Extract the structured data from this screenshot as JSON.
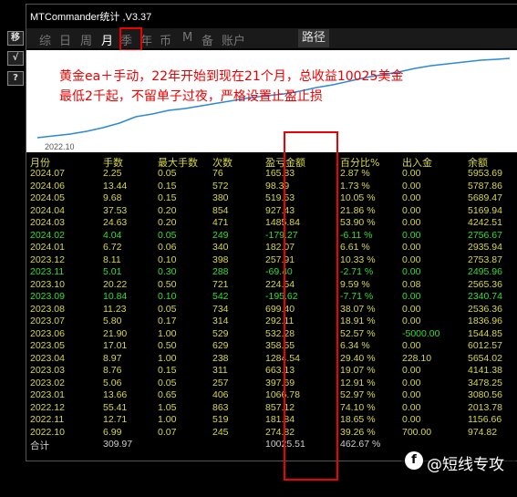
{
  "window": {
    "title": "MTCommander统计 ,V3.37"
  },
  "toolbar": {
    "buttons": [
      "移",
      "√",
      "?"
    ]
  },
  "nav": {
    "items": [
      "综",
      "日",
      "周",
      "月",
      "季",
      "年",
      "币",
      "M",
      "备",
      "账户"
    ],
    "active": "月",
    "path_button": "路径"
  },
  "chart": {
    "overlay_line1": "黄金ea＋手动，22年开始到现在21个月，总收益10025美金",
    "overlay_line2": "最低2千起，不留单子过夜，严格设置止盈止损",
    "axis_label": "2022.10"
  },
  "table": {
    "headers": [
      "月份",
      "手数",
      "最大手数",
      "次数",
      "盈亏金额",
      "百分比%",
      "出入金",
      "余额"
    ],
    "rows": [
      {
        "month": "2024.07",
        "lots": "2.25",
        "max": "0.05",
        "count": "76",
        "pnl": "165.83",
        "pct": "2.87 %",
        "io": "0.00",
        "bal": "5953.69",
        "neg": false
      },
      {
        "month": "2024.06",
        "lots": "13.44",
        "max": "0.15",
        "count": "572",
        "pnl": "98.39",
        "pct": "1.73 %",
        "io": "0.00",
        "bal": "5787.86",
        "neg": false
      },
      {
        "month": "2024.05",
        "lots": "9.68",
        "max": "0.15",
        "count": "380",
        "pnl": "519.53",
        "pct": "10.05 %",
        "io": "0.00",
        "bal": "5689.47",
        "neg": false
      },
      {
        "month": "2024.04",
        "lots": "37.53",
        "max": "0.20",
        "count": "854",
        "pnl": "927.43",
        "pct": "21.86 %",
        "io": "0.00",
        "bal": "5169.94",
        "neg": false
      },
      {
        "month": "2024.03",
        "lots": "24.63",
        "max": "0.20",
        "count": "471",
        "pnl": "1485.84",
        "pct": "53.90 %",
        "io": "0.00",
        "bal": "4242.51",
        "neg": false
      },
      {
        "month": "2024.02",
        "lots": "4.04",
        "max": "0.05",
        "count": "249",
        "pnl": "-179.27",
        "pct": "-6.11 %",
        "io": "0.00",
        "bal": "2756.67",
        "neg": true
      },
      {
        "month": "2024.01",
        "lots": "6.72",
        "max": "0.06",
        "count": "340",
        "pnl": "182.07",
        "pct": "6.61 %",
        "io": "0.00",
        "bal": "2935.94",
        "neg": false
      },
      {
        "month": "2023.12",
        "lots": "8.11",
        "max": "0.10",
        "count": "398",
        "pnl": "257.91",
        "pct": "10.33 %",
        "io": "0.00",
        "bal": "2753.87",
        "neg": false
      },
      {
        "month": "2023.11",
        "lots": "5.01",
        "max": "0.30",
        "count": "288",
        "pnl": "-69.40",
        "pct": "-2.71 %",
        "io": "0.00",
        "bal": "2495.96",
        "neg": true
      },
      {
        "month": "2023.10",
        "lots": "20.22",
        "max": "0.50",
        "count": "721",
        "pnl": "224.54",
        "pct": "9.59 %",
        "io": "0.08",
        "bal": "2565.36",
        "neg": false
      },
      {
        "month": "2023.09",
        "lots": "10.84",
        "max": "0.10",
        "count": "542",
        "pnl": "-195.62",
        "pct": "-7.71 %",
        "io": "0.00",
        "bal": "2340.74",
        "neg": true
      },
      {
        "month": "2023.08",
        "lots": "11.23",
        "max": "0.05",
        "count": "734",
        "pnl": "699.40",
        "pct": "38.07 %",
        "io": "0.00",
        "bal": "2536.36",
        "neg": false
      },
      {
        "month": "2023.07",
        "lots": "5.80",
        "max": "0.17",
        "count": "314",
        "pnl": "292.11",
        "pct": "18.91 %",
        "io": "0.00",
        "bal": "1836.96",
        "neg": false
      },
      {
        "month": "2023.06",
        "lots": "21.90",
        "max": "1.00",
        "count": "529",
        "pnl": "532.28",
        "pct": "52.57 %",
        "io": "-5000.00",
        "bal": "1544.85",
        "neg": false,
        "io_neg": true
      },
      {
        "month": "2023.05",
        "lots": "17.01",
        "max": "0.50",
        "count": "629",
        "pnl": "358.55",
        "pct": "6.34 %",
        "io": "0.00",
        "bal": "6012.57",
        "neg": false
      },
      {
        "month": "2023.04",
        "lots": "8.97",
        "max": "1.00",
        "count": "238",
        "pnl": "1284.54",
        "pct": "29.40 %",
        "io": "228.10",
        "bal": "5654.02",
        "neg": false
      },
      {
        "month": "2023.03",
        "lots": "8.76",
        "max": "0.15",
        "count": "311",
        "pnl": "663.13",
        "pct": "19.07 %",
        "io": "0.00",
        "bal": "4141.38",
        "neg": false
      },
      {
        "month": "2023.02",
        "lots": "5.06",
        "max": "0.05",
        "count": "257",
        "pnl": "397.69",
        "pct": "12.91 %",
        "io": "0.00",
        "bal": "3478.25",
        "neg": false
      },
      {
        "month": "2023.01",
        "lots": "13.66",
        "max": "0.65",
        "count": "406",
        "pnl": "1066.78",
        "pct": "52.97 %",
        "io": "0.00",
        "bal": "3080.56",
        "neg": false
      },
      {
        "month": "2022.12",
        "lots": "55.41",
        "max": "1.05",
        "count": "863",
        "pnl": "857.12",
        "pct": "74.10 %",
        "io": "0.00",
        "bal": "2013.78",
        "neg": false
      },
      {
        "month": "2022.11",
        "lots": "12.71",
        "max": "1.00",
        "count": "519",
        "pnl": "181.84",
        "pct": "18.65 %",
        "io": "0.00",
        "bal": "1156.66",
        "neg": false
      },
      {
        "month": "2022.10",
        "lots": "6.99",
        "max": "0.07",
        "count": "245",
        "pnl": "274.82",
        "pct": "39.26 %",
        "io": "700.00",
        "bal": "974.82",
        "neg": false
      }
    ],
    "total": {
      "month": "合计",
      "lots": "309.97",
      "pnl": "10025.51",
      "pct": "462.67 %"
    }
  },
  "watermark": {
    "logo": "f",
    "text": "@短线专攻"
  },
  "colors": {
    "text": "#d8d840",
    "negative": "#33dd33",
    "highlight": "#ee0000",
    "chart_line": "#2a8ad8"
  }
}
